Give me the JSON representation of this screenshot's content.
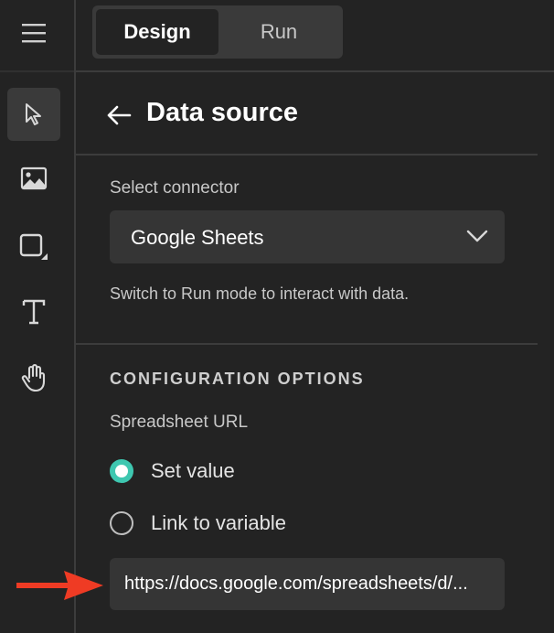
{
  "modes": {
    "design_label": "Design",
    "run_label": "Run",
    "active": "Design"
  },
  "rail": {
    "tools": [
      {
        "icon": "cursor-icon",
        "active": true
      },
      {
        "icon": "image-icon",
        "active": false
      },
      {
        "icon": "rectangle-icon",
        "active": false
      },
      {
        "icon": "text-icon",
        "active": false
      },
      {
        "icon": "hand-icon",
        "active": false
      }
    ]
  },
  "panel": {
    "title": "Data source",
    "connector": {
      "label": "Select connector",
      "value": "Google Sheets",
      "hint": "Switch to Run mode to interact with data."
    },
    "config": {
      "section_title": "CONFIGURATION OPTIONS",
      "field_label": "Spreadsheet URL",
      "options": [
        {
          "label": "Set value",
          "checked": true
        },
        {
          "label": "Link to variable",
          "checked": false
        }
      ],
      "url_value": "https://docs.google.com/spreadsheets/d/..."
    }
  },
  "colors": {
    "accent": "#3ec7b0",
    "annotation_arrow": "#ef3b24",
    "background": "#232323",
    "field_bg": "#353535"
  }
}
